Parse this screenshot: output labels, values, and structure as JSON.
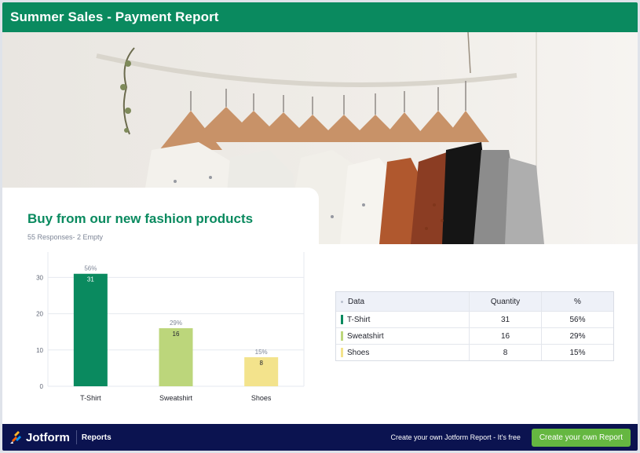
{
  "header": {
    "title": "Summer Sales - Payment Report"
  },
  "card": {
    "title": "Buy from our new fashion products",
    "subtitle": "55 Responses- 2 Empty"
  },
  "chart_data": {
    "type": "bar",
    "categories": [
      "T-Shirt",
      "Sweatshirt",
      "Shoes"
    ],
    "values": [
      31,
      16,
      8
    ],
    "percent_labels": [
      "56%",
      "29%",
      "15%"
    ],
    "colors": [
      "#0a8a5f",
      "#bcd67b",
      "#f3e38c"
    ],
    "value_label_colors": [
      "#ffffff",
      "#23252e",
      "#23252e"
    ],
    "yticks": [
      "0",
      "10",
      "20",
      "30"
    ],
    "ylim": [
      0,
      37
    ],
    "grid": true
  },
  "table": {
    "headers": [
      "Data",
      "Quantity",
      "%"
    ],
    "rows": [
      {
        "label": "T-Shirt",
        "quantity": "31",
        "percent": "56%",
        "color": "#0a8a5f"
      },
      {
        "label": "Sweatshirt",
        "quantity": "16",
        "percent": "29%",
        "color": "#bcd67b"
      },
      {
        "label": "Shoes",
        "quantity": "8",
        "percent": "15%",
        "color": "#f3e38c"
      }
    ]
  },
  "footer": {
    "brand": "Jotform",
    "section": "Reports",
    "cta_text": "Create your own Jotform Report - It's free",
    "cta_button": "Create your own Report"
  },
  "icons": {
    "logo": "jotform-logo-icon",
    "hero": "clothes-rack-photo"
  }
}
